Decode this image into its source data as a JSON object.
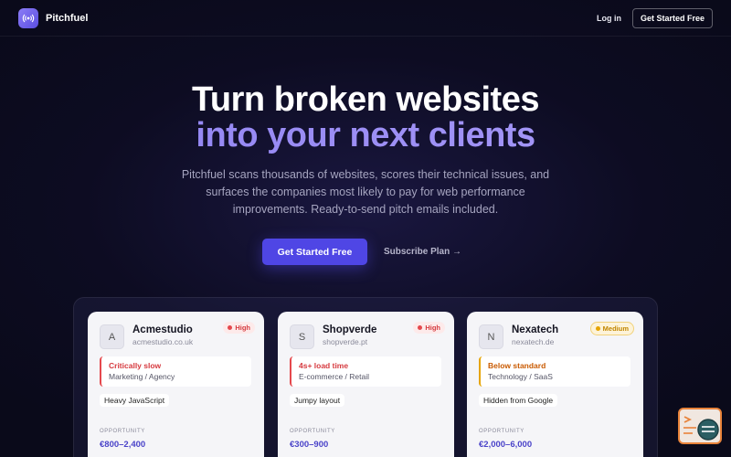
{
  "nav": {
    "brand": "Pitchfuel",
    "login": "Log in",
    "cta": "Get Started Free"
  },
  "hero": {
    "title_line1": "Turn broken websites",
    "title_line2": "into your next clients",
    "subtitle": "Pitchfuel scans thousands of websites, scores their technical issues, and surfaces the companies most likely to pay for web performance improvements. Ready-to-send pitch emails included.",
    "primary_cta": "Get Started Free",
    "secondary_cta": "Subscribe Plan →"
  },
  "cards": [
    {
      "initial": "A",
      "name": "Acmestudio",
      "domain": "acmestudio.co.uk",
      "badge": "High",
      "issue_title": "Critically slow",
      "issue_sub": "Marketing / Agency",
      "tag": "Heavy JavaScript",
      "opp_label": "OPPORTUNITY",
      "opp_value": "€800–2,400"
    },
    {
      "initial": "S",
      "name": "Shopverde",
      "domain": "shopverde.pt",
      "badge": "High",
      "issue_title": "4s+ load time",
      "issue_sub": "E-commerce / Retail",
      "tag": "Jumpy layout",
      "opp_label": "OPPORTUNITY",
      "opp_value": "€300–900"
    },
    {
      "initial": "N",
      "name": "Nexatech",
      "domain": "nexatech.de",
      "badge": "Medium",
      "issue_title": "Below standard",
      "issue_sub": "Technology / SaaS",
      "tag": "Hidden from Google",
      "opp_label": "OPPORTUNITY",
      "opp_value": "€2,000–6,000"
    }
  ],
  "colors": {
    "accent": "#4f46e5",
    "high": "#e5484d",
    "medium": "#e6a400"
  },
  "icons": {
    "logo": "broadcast-icon",
    "widget": "support-chat-icon"
  }
}
